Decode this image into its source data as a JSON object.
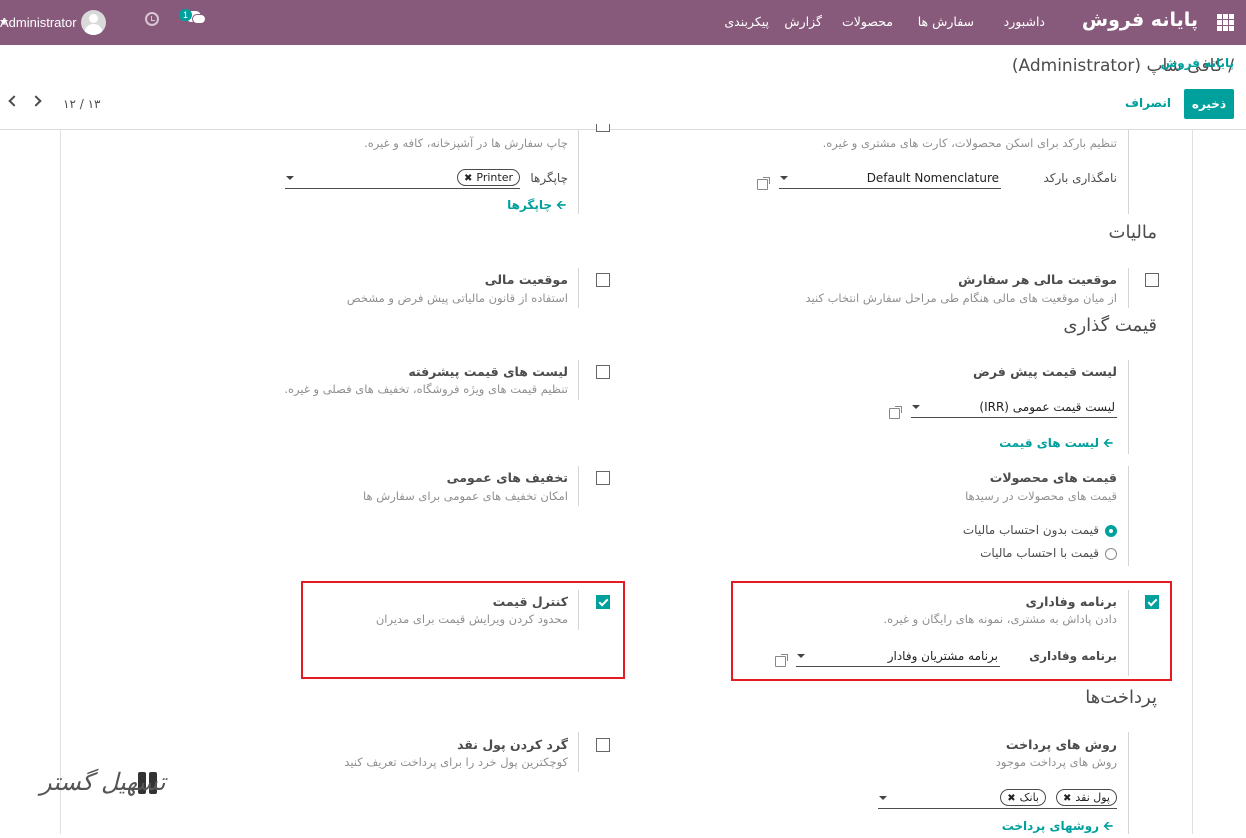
{
  "topbar": {
    "brand": "پایانه فروش",
    "menu": [
      "داشبورد",
      "سفارش ها",
      "محصولات",
      "گزارش",
      "پیکربندی"
    ],
    "user": "Administrator",
    "chat_badge": "1",
    "accent": "#875a7b"
  },
  "breadcrumb": {
    "parent": "پایانه فروش",
    "separator": "/",
    "current": "کافی شاپ (Administrator)"
  },
  "actions": {
    "save": "ذخیره",
    "discard": "انصراف"
  },
  "pager": {
    "text": "۱۲ / ۱۳"
  },
  "top_partial": {
    "left_desc": "چاپ سفارش ها در آشپزخانه، کافه و غیره.",
    "printers_label": "چاپگرها",
    "printer_tag": "Printer",
    "printers_link": "چاپگرها",
    "right_desc": "تنظیم بارکد برای اسکن محصولات، کارت های مشتری و غیره.",
    "nomenclature_label": "نامگذاری بارکد",
    "nomenclature_value": "Default Nomenclature"
  },
  "taxes": {
    "heading": "مالیات",
    "fiscal_per_order_title": "موقعیت مالی هر سفارش",
    "fiscal_per_order_desc": "از میان موقعیت های مالی هنگام طی مراحل سفارش انتخاب کنید",
    "fiscal_title": "موقعیت مالی",
    "fiscal_desc": "استفاده از قانون مالیاتی پیش فرض و مشخص"
  },
  "pricing": {
    "heading": "قیمت گذاری",
    "default_pricelist_title": "لیست قیمت پیش فرض",
    "default_pricelist_value": "لیست قیمت عمومی (IRR)",
    "pricelists_link": "لیست های قیمت",
    "advanced_title": "لیست های قیمت پیشرفته",
    "advanced_desc": "تنظیم قیمت های ویژه فروشگاه، تخفیف های فصلی و غیره.",
    "product_prices_title": "قیمت های محصولات",
    "product_prices_desc": "قیمت های محصولات در رسیدها",
    "radio_excluded": "قیمت بدون احتساب مالیات",
    "radio_included": "قیمت با احتساب مالیات",
    "global_discounts_title": "تخفیف های عمومی",
    "global_discounts_desc": "امکان تخفیف های عمومی برای سفارش ها",
    "loyalty_title": "برنامه وفاداری",
    "loyalty_desc": "دادن پاداش به مشتری، نمونه های رایگان و غیره.",
    "loyalty_field_label": "برنامه وفاداری",
    "loyalty_field_value": "برنامه مشتریان وفادار",
    "price_control_title": "کنترل قیمت",
    "price_control_desc": "محدود کردن ویرایش قیمت برای مدیران"
  },
  "payments": {
    "heading": "پرداخت‌ها",
    "methods_title": "روش های پرداخت",
    "methods_desc": "روش های پرداخت موجود",
    "tag_cash": "پول نقد",
    "tag_bank": "بانک",
    "methods_link": "روشهای پرداخت",
    "rounding_title": "گرد کردن پول نقد",
    "rounding_desc": "کوچکترین پول خرد را برای پرداخت تعریف کنید"
  },
  "watermark": {
    "text": "تسهیل گستر"
  }
}
